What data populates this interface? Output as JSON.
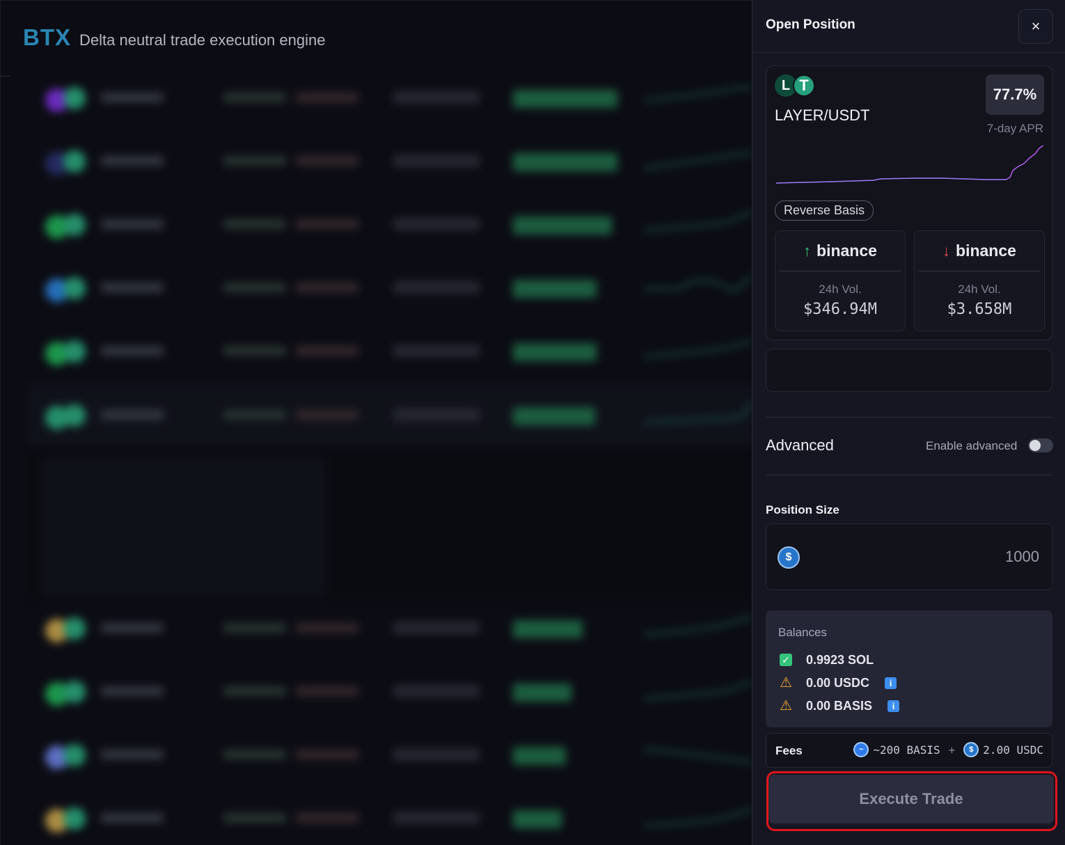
{
  "app": {
    "brand": "BTX",
    "tagline": "Delta neutral trade execution engine"
  },
  "panel": {
    "title": "Open Position",
    "close_label": "×",
    "position": {
      "pair": "LAYER/USDT",
      "token_a_glyph": "L",
      "token_b_glyph": "T",
      "apr_value": "77.7%",
      "apr_label": "7-day APR",
      "strategy": "Reverse Basis",
      "chart_line_color": "#b45cf0",
      "long": {
        "exchange": "binance",
        "direction_icon": "arrow-up-icon",
        "vol_label": "24h Vol.",
        "vol_value": "$346.94M"
      },
      "short": {
        "exchange": "binance",
        "direction_icon": "arrow-down-icon",
        "vol_label": "24h Vol.",
        "vol_value": "$3.658M"
      }
    },
    "advanced": {
      "title": "Advanced",
      "toggle_label": "Enable advanced",
      "enabled": false
    },
    "position_size": {
      "label": "Position Size",
      "placeholder": "1000",
      "currency_icon": "usdc-icon"
    },
    "balances": {
      "title": "Balances",
      "items": [
        {
          "status": "ok",
          "text": "0.9923 SOL"
        },
        {
          "status": "warning",
          "text": "0.00 USDC",
          "info": "i"
        },
        {
          "status": "warning",
          "text": "0.00 BASIS",
          "info": "i"
        }
      ]
    },
    "fees": {
      "label": "Fees",
      "basis_amount": "~200 BASIS",
      "plus": "+",
      "usdc_amount": "2.00 USDC"
    },
    "execute_label": "Execute Trade"
  },
  "colors": {
    "accent_brand": "#2a86b4",
    "long_green": "#35c37b",
    "short_red": "#e5484d",
    "warning": "#f4a62a",
    "highlight_outline": "#e1151c"
  }
}
